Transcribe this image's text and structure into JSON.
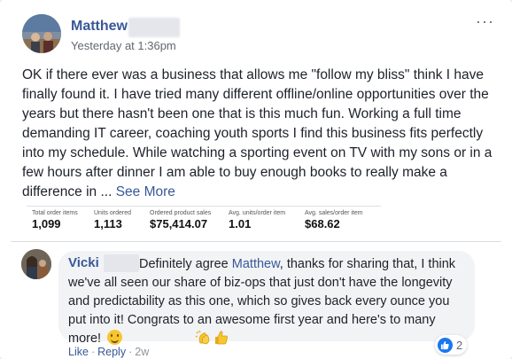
{
  "post": {
    "author": "Matthew",
    "timestamp": "Yesterday at 1:36pm",
    "more_menu": "···",
    "body": "OK if there ever was a business that allows me \"follow my bliss\" think I have finally found it. I have tried many different offline/online opportunities over the years but there hasn't been one that is this much fun. Working a full time demanding IT career, coaching youth sports I find this business fits perfectly into my schedule. While watching a sporting event on TV with my sons or in a few hours after dinner I am able to buy enough books to really make a difference in ...",
    "see_more": "See More"
  },
  "stats": [
    {
      "label": "Total order items",
      "value": "1,099"
    },
    {
      "label": "Units ordered",
      "value": "1,113"
    },
    {
      "label": "Ordered product sales",
      "value": "$75,414.07"
    },
    {
      "label": "Avg. units/order item",
      "value": "1.01"
    },
    {
      "label": "Avg. sales/order item",
      "value": "$68.62"
    }
  ],
  "comment": {
    "author": "Vicki",
    "text_before": "Definitely agree ",
    "mention": "Matthew",
    "text_after": ", thanks for sharing that, I think we've all seen our share of biz-ops that just don't have the longevity and predictability as this one, which so gives back every ounce you put into it! Congrats to an awesome first year and here's to many more!",
    "reaction_count": "2",
    "actions": {
      "like": "Like",
      "reply": "Reply",
      "separator": "·",
      "age": "2w"
    }
  },
  "colors": {
    "link_blue": "#385898",
    "text": "#1d2129",
    "meta_gray": "#616770",
    "like_blue": "#1877f2"
  }
}
